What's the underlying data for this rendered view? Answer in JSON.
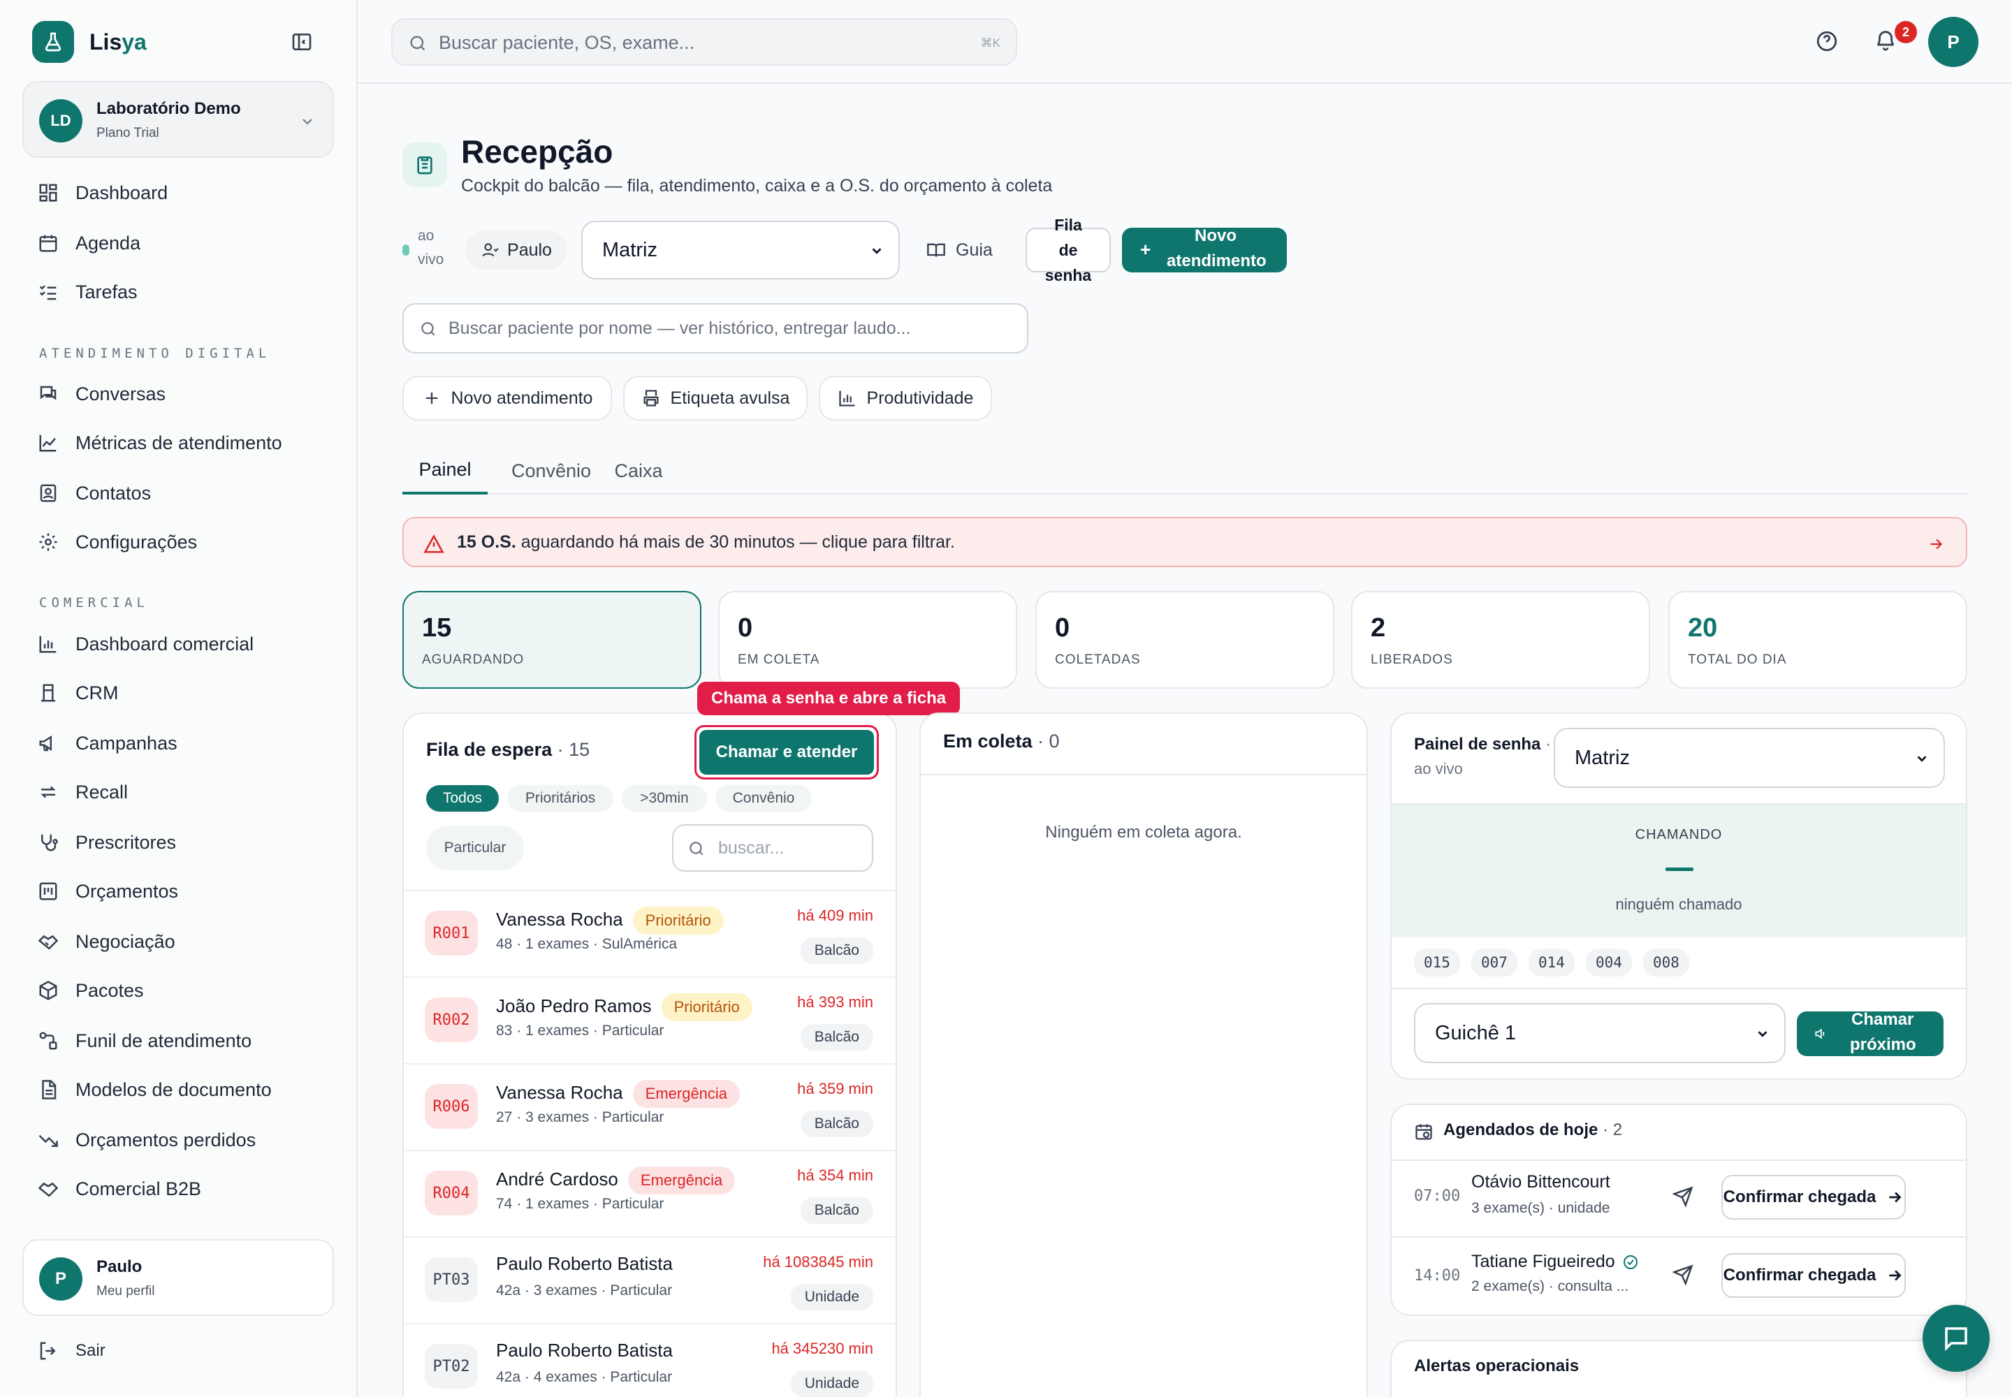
{
  "brand": {
    "name_part1": "Lis",
    "name_part2": "ya"
  },
  "org": {
    "initials": "LD",
    "name": "Laboratório Demo",
    "plan": "Plano Trial"
  },
  "nav": {
    "main": [
      {
        "label": "Dashboard",
        "icon": "dashboard-icon"
      },
      {
        "label": "Agenda",
        "icon": "calendar-icon"
      },
      {
        "label": "Tarefas",
        "icon": "tasks-icon"
      }
    ],
    "section_digital": "ATENDIMENTO DIGITAL",
    "digital": [
      {
        "label": "Conversas",
        "icon": "chat-icon"
      },
      {
        "label": "Métricas de atendimento",
        "icon": "chart-line-icon"
      },
      {
        "label": "Contatos",
        "icon": "contacts-icon"
      },
      {
        "label": "Configurações",
        "icon": "gear-icon"
      }
    ],
    "section_comercial": "COMERCIAL",
    "comercial": [
      {
        "label": "Dashboard comercial",
        "icon": "bar-chart-icon"
      },
      {
        "label": "CRM",
        "icon": "crm-icon"
      },
      {
        "label": "Campanhas",
        "icon": "megaphone-icon"
      },
      {
        "label": "Recall",
        "icon": "recall-icon"
      },
      {
        "label": "Prescritores",
        "icon": "stethoscope-icon"
      },
      {
        "label": "Orçamentos",
        "icon": "budget-icon"
      },
      {
        "label": "Negociação",
        "icon": "handshake-icon"
      },
      {
        "label": "Pacotes",
        "icon": "package-icon"
      },
      {
        "label": "Funil de atendimento",
        "icon": "funnel-icon"
      },
      {
        "label": "Modelos de documento",
        "icon": "document-icon"
      },
      {
        "label": "Orçamentos perdidos",
        "icon": "trend-down-icon"
      },
      {
        "label": "Comercial B2B",
        "icon": "b2b-icon"
      }
    ]
  },
  "profile": {
    "initial": "P",
    "name": "Paulo",
    "subtitle": "Meu perfil"
  },
  "logout": "Sair",
  "topbar": {
    "search_placeholder": "Buscar paciente, OS, exame...",
    "shortcut": "⌘K",
    "notifications": "2",
    "avatar": "P"
  },
  "page": {
    "title": "Recepção",
    "subtitle": "Cockpit do balcão — fila, atendimento, caixa e a O.S. do orçamento à coleta"
  },
  "controls": {
    "live_line1": "ao",
    "live_line2": "vivo",
    "user": "Paulo",
    "unit": "Matriz",
    "guide": "Guia",
    "queue_l1": "Fila",
    "queue_l2": "de",
    "queue_l3": "senha",
    "new_l1": "Novo",
    "new_l2": "atendimento",
    "new_plus": "+"
  },
  "patient_search": "Buscar paciente por nome — ver histórico, entregar laudo...",
  "quick": {
    "new": "Novo atendimento",
    "label": "Etiqueta avulsa",
    "prod": "Produtividade"
  },
  "tabs": [
    "Painel",
    "Convênio",
    "Caixa"
  ],
  "alert": {
    "strong": "15 O.S.",
    "text": " aguardando há mais de 30 minutos — clique para filtrar."
  },
  "stats": [
    {
      "value": "15",
      "label": "AGUARDANDO"
    },
    {
      "value": "0",
      "label": "EM COLETA"
    },
    {
      "value": "0",
      "label": "COLETADAS"
    },
    {
      "value": "2",
      "label": "LIBERADOS"
    },
    {
      "value": "20",
      "label": "TOTAL DO DIA"
    }
  ],
  "queue": {
    "title": "Fila de espera",
    "count": " · 15",
    "tooltip": "Chama a senha e abre a ficha",
    "call_btn": "Chamar e atender",
    "filters": [
      "Todos",
      "Prioritários",
      ">30min",
      "Convênio",
      "Particular"
    ],
    "search_placeholder": "buscar...",
    "rows": [
      {
        "code": "R001",
        "name": "Vanessa Rocha",
        "pill": "Prioritário",
        "sub": "48 · 1 exames · SulAmérica",
        "time": "há 409 min",
        "tag": "Balcão"
      },
      {
        "code": "R002",
        "name": "João Pedro Ramos",
        "pill": "Prioritário",
        "sub": "83 · 1 exames · Particular",
        "time": "há 393 min",
        "tag": "Balcão"
      },
      {
        "code": "R006",
        "name": "Vanessa Rocha",
        "pill": "Emergência",
        "sub": "27 · 3 exames · Particular",
        "time": "há 359 min",
        "tag": "Balcão"
      },
      {
        "code": "R004",
        "name": "André Cardoso",
        "pill": "Emergência",
        "sub": "74 · 1 exames · Particular",
        "time": "há 354 min",
        "tag": "Balcão"
      },
      {
        "code": "PT03",
        "name": "Paulo Roberto Batista",
        "pill": "",
        "sub": "42a · 3 exames · Particular",
        "time": "há 1083845 min",
        "tag": "Unidade"
      },
      {
        "code": "PT02",
        "name": "Paulo Roberto Batista",
        "pill": "",
        "sub": "42a · 4 exames · Particular",
        "time": "há 345230 min",
        "tag": "Unidade"
      }
    ]
  },
  "collection": {
    "title": "Em coleta",
    "count": " · 0",
    "empty": "Ninguém em coleta agora."
  },
  "senha": {
    "title": "Painel de senha",
    "dot": " ·",
    "live": "ao vivo",
    "unit": "Matriz",
    "calling": "CHAMANDO",
    "nobody": "ninguém chamado",
    "recent": [
      "015",
      "007",
      "014",
      "004",
      "008"
    ],
    "guiche": "Guichê 1",
    "call_l1": "Chamar",
    "call_l2": "próximo"
  },
  "agenda": {
    "title": "Agendados de hoje",
    "count": " · 2",
    "items": [
      {
        "time": "07:00",
        "name": "Otávio Bittencourt",
        "sub": "3 exame(s) · unidade",
        "btn": "Confirmar chegada"
      },
      {
        "time": "14:00",
        "name": "Tatiane Figueiredo",
        "sub": "2 exame(s) · consulta ...",
        "btn": "Confirmar chegada"
      }
    ]
  },
  "alerts_title": "Alertas operacionais",
  "colors": {
    "accent": "#0f766e",
    "danger": "#dc2626",
    "tooltip": "#e11d48"
  }
}
